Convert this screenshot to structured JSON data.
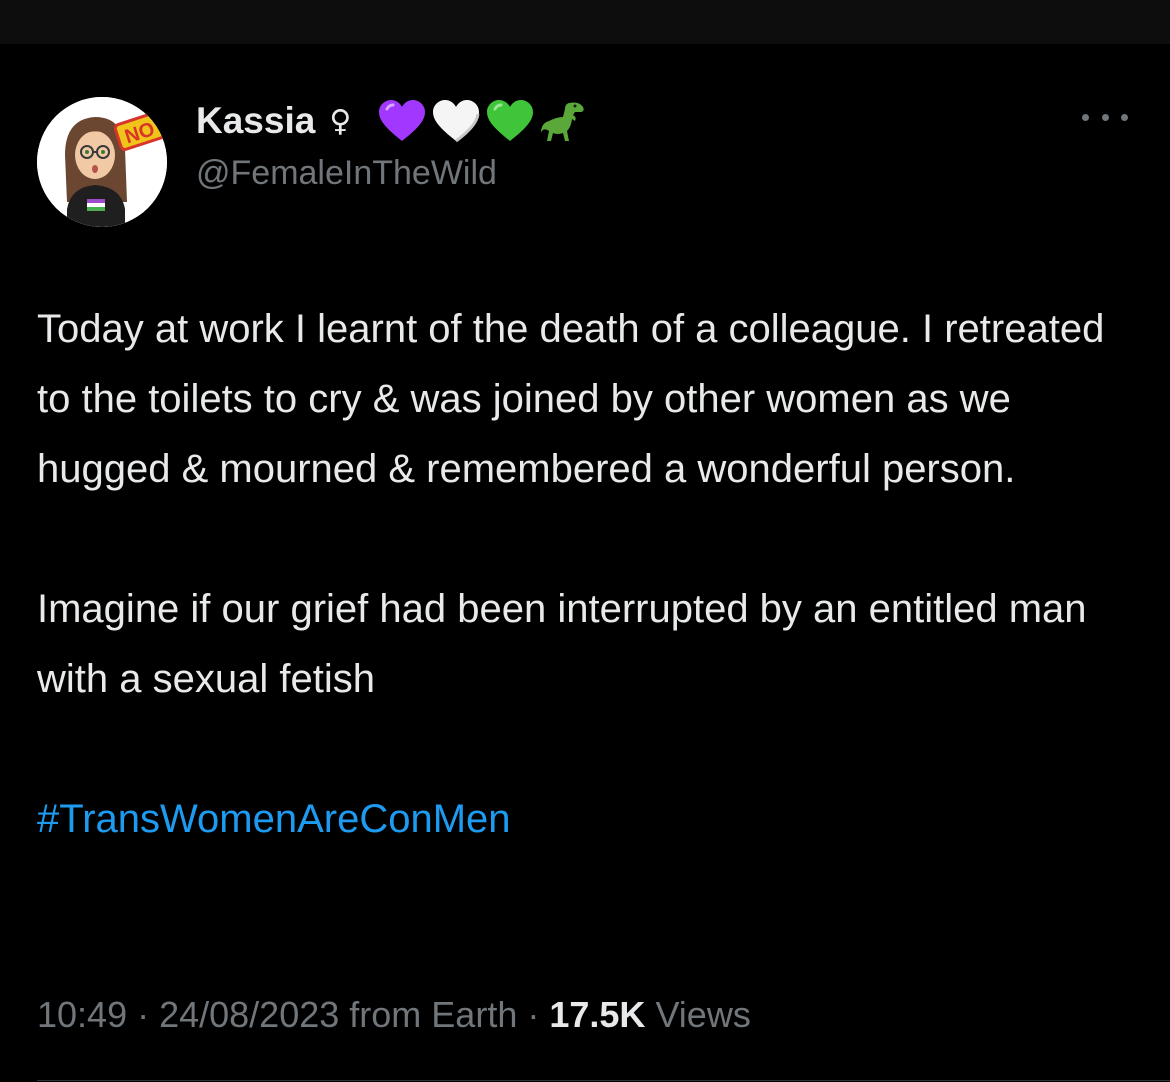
{
  "author": {
    "display_name": "Kassia",
    "female_symbol": "♀",
    "handle": "@FemaleInTheWild",
    "avatar_badge_text": "NO",
    "emoji_badges": [
      "purple-heart-icon",
      "white-heart-icon",
      "green-heart-icon",
      "t-rex-icon"
    ]
  },
  "tweet": {
    "paragraph_1": "Today at work I learnt of the death of a colleague. I retreated to the toilets to cry & was joined by other women as we hugged & mourned & remembered a wonderful person.",
    "paragraph_2": "Imagine if our grief had been interrupted by an entitled man with a sexual fetish",
    "hashtag": "#TransWomenAreConMen"
  },
  "meta": {
    "time": "10:49",
    "separator": " · ",
    "date": "24/08/2023",
    "source": "from Earth",
    "views_count": "17.5K",
    "views_label": "Views"
  },
  "colors": {
    "background": "#000000",
    "text": "#e7e9ea",
    "secondary_text": "#71767b",
    "link": "#1d9bf0",
    "purple_heart": "#a238ff",
    "white_heart": "#f5f5f5",
    "green_heart": "#3fc43a"
  }
}
